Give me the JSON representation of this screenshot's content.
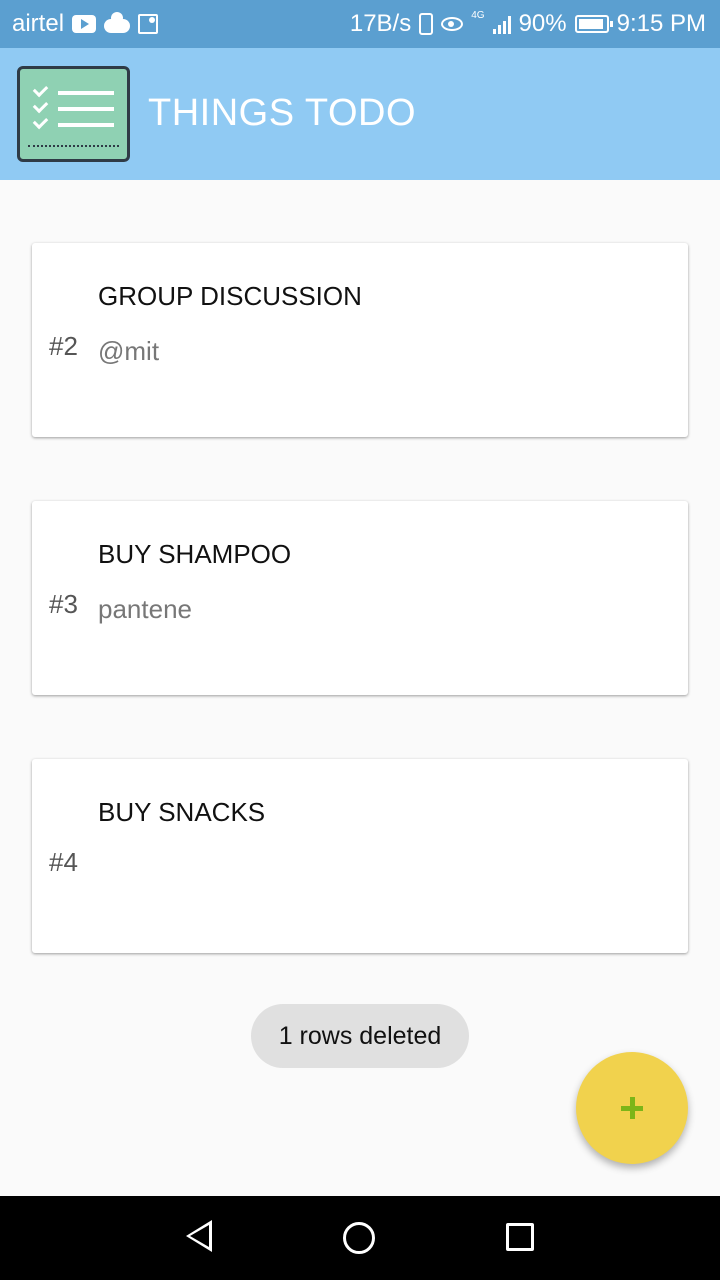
{
  "status_bar": {
    "carrier": "airtel",
    "net_speed": "17B/s",
    "network_type": "4G",
    "battery": "90%",
    "time": "9:15 PM",
    "icons": [
      "youtube-icon",
      "cloud-icon",
      "map-icon",
      "vibrate-icon",
      "eye-icon",
      "signal-icon",
      "battery-icon"
    ]
  },
  "app_bar": {
    "title": "THINGS TODO",
    "logo_icon": "checklist-icon"
  },
  "todos": [
    {
      "number": "#2",
      "title": "GROUP DISCUSSION",
      "note": "@mit"
    },
    {
      "number": "#3",
      "title": "BUY SHAMPOO",
      "note": "pantene"
    },
    {
      "number": "#4",
      "title": "BUY SNACKS",
      "note": ""
    }
  ],
  "toast": {
    "message": "1 rows deleted"
  },
  "fab": {
    "icon": "plus-icon",
    "color": "#f1d24d"
  },
  "nav_bar": {
    "icons": [
      "back-icon",
      "home-icon",
      "recents-icon"
    ]
  }
}
